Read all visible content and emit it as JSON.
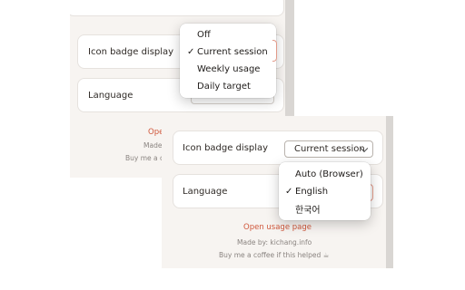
{
  "back_panel": {
    "icon_badge_label": "Icon badge display",
    "language_label": "Language",
    "footer_link_partial": "Ope",
    "footer_made_partial": "Made",
    "footer_buy_partial": "Buy me a c",
    "menu": {
      "items": [
        "Off",
        "Current session",
        "Weekly usage",
        "Daily target"
      ],
      "selected": "Current session",
      "check_glyph": "✓"
    }
  },
  "front_panel": {
    "icon_badge_label": "Icon badge display",
    "icon_badge_value": "Current session",
    "language_label": "Language",
    "footer_link": "Open usage page",
    "footer_made": "Made by: kichang.info",
    "footer_buy": "Buy me a coffee if this helped ☕",
    "menu": {
      "items": [
        "Auto (Browser)",
        "English",
        "한국어"
      ],
      "selected": "English",
      "check_glyph": "✓"
    }
  },
  "colors": {
    "accent": "#d0583c",
    "panel_bg": "#f7f4f1",
    "card_bg": "#ffffff"
  }
}
